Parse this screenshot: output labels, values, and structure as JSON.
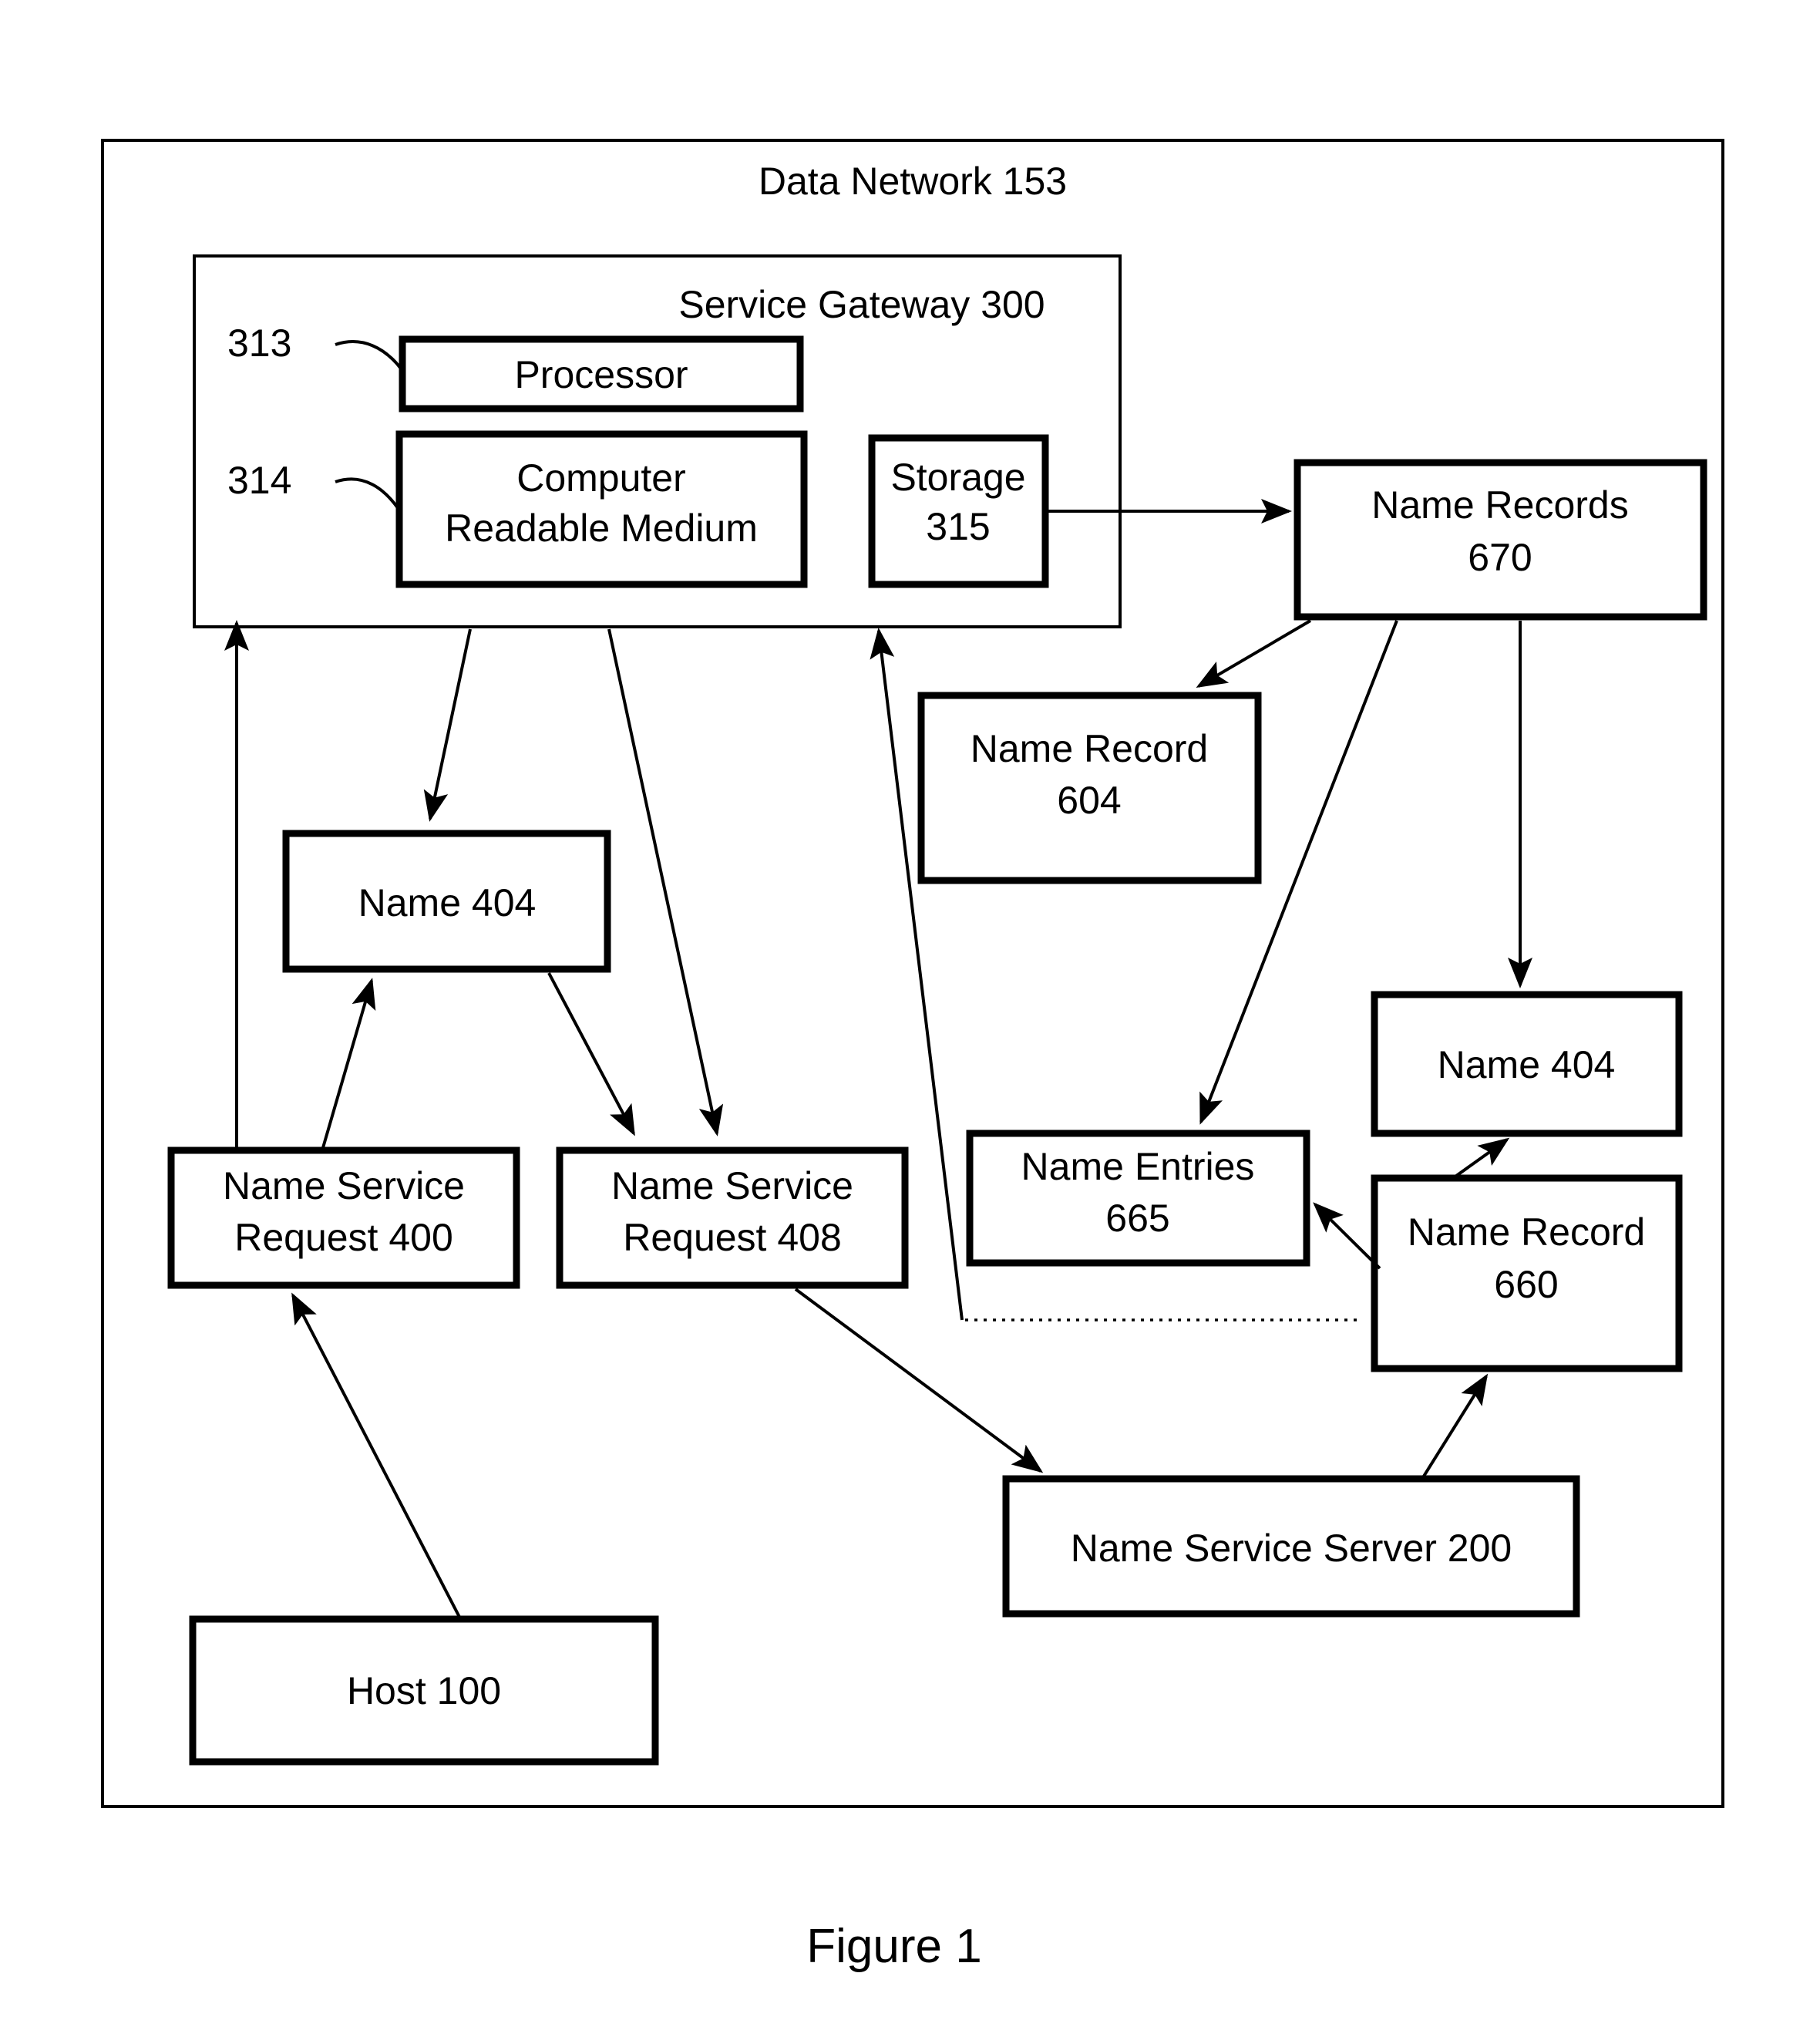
{
  "figure": {
    "caption": "Figure 1"
  },
  "diagram": {
    "type": "patent-block-diagram",
    "outer_container": {
      "label": "Data Network 153"
    },
    "gateway_container": {
      "label": "Service Gateway 300"
    },
    "reference_numerals": [
      {
        "id": "313",
        "points_to": "Processor"
      },
      {
        "id": "314",
        "points_to": "Computer Readable Medium"
      }
    ],
    "boxes": [
      {
        "key": "processor",
        "line1": "Processor",
        "line2": ""
      },
      {
        "key": "crm",
        "line1": "Computer",
        "line2": "Readable Medium"
      },
      {
        "key": "storage",
        "line1": "Storage",
        "line2": "315"
      },
      {
        "key": "name_records_670",
        "line1": "Name Records",
        "line2": "670"
      },
      {
        "key": "name_record_604",
        "line1": "Name Record",
        "line2": "604"
      },
      {
        "key": "name_404_left",
        "line1": "Name 404",
        "line2": ""
      },
      {
        "key": "name_404_right",
        "line1": "Name 404",
        "line2": ""
      },
      {
        "key": "name_entries_665",
        "line1": "Name Entries",
        "line2": "665"
      },
      {
        "key": "name_record_660",
        "line1": "Name Record",
        "line2": "660"
      },
      {
        "key": "nsr_400",
        "line1": "Name Service",
        "line2": "Request 400"
      },
      {
        "key": "nsr_408",
        "line1": "Name Service",
        "line2": "Request 408"
      },
      {
        "key": "name_service_server_200",
        "line1": "Name Service Server 200",
        "line2": ""
      },
      {
        "key": "host_100",
        "line1": "Host 100",
        "line2": ""
      }
    ],
    "connections": [
      {
        "from": "storage",
        "to": "name_records_670",
        "style": "solid-arrow"
      },
      {
        "from": "name_records_670",
        "to": "name_record_604",
        "style": "solid-arrow"
      },
      {
        "from": "name_records_670",
        "to": "name_entries_665",
        "style": "solid-arrow"
      },
      {
        "from": "name_records_670",
        "to": "name_404_right",
        "style": "solid-arrow"
      },
      {
        "from": "service_gateway",
        "to": "name_404_left",
        "style": "solid-arrow"
      },
      {
        "from": "service_gateway",
        "to": "nsr_408",
        "style": "solid-arrow"
      },
      {
        "from": "name_404_left",
        "to": "nsr_408",
        "style": "solid-arrow"
      },
      {
        "from": "nsr_400",
        "to": "service_gateway",
        "style": "solid-arrow"
      },
      {
        "from": "nsr_400",
        "to": "name_404_left",
        "style": "solid-arrow"
      },
      {
        "from": "host_100",
        "to": "nsr_400",
        "style": "solid-arrow"
      },
      {
        "from": "nsr_408",
        "to": "name_service_server_200",
        "style": "solid-arrow"
      },
      {
        "from": "name_service_server_200",
        "to": "name_record_660",
        "style": "solid-arrow"
      },
      {
        "from": "name_record_660",
        "to": "name_entries_665",
        "style": "solid-arrow"
      },
      {
        "from": "name_record_660",
        "to": "name_404_right",
        "style": "solid-arrow"
      },
      {
        "from": "name_record_660",
        "to": "service_gateway",
        "style": "dotted-then-solid-arrow"
      }
    ],
    "colors": {
      "stroke": "#000000",
      "fill": "#ffffff",
      "text": "#000000"
    }
  }
}
